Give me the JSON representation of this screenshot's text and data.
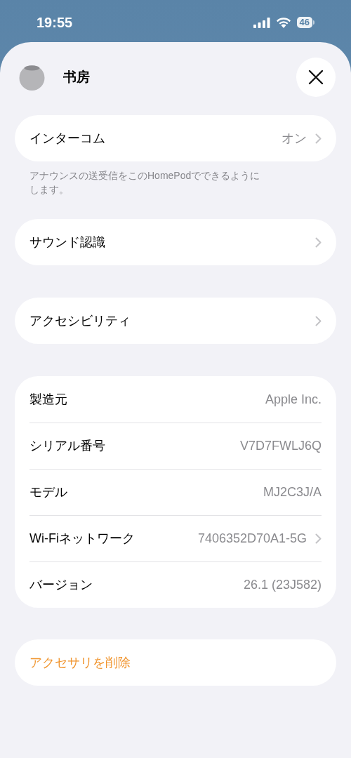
{
  "status_bar": {
    "time": "19:55",
    "battery": "46"
  },
  "header": {
    "title": "书房"
  },
  "groups": [
    {
      "rows": [
        {
          "label": "インターコム",
          "value": "オン",
          "chevron": true
        }
      ],
      "footer": "アナウンスの送受信をこのHomePodでできるようにします。"
    },
    {
      "rows": [
        {
          "label": "サウンド認識",
          "chevron": true
        }
      ]
    },
    {
      "rows": [
        {
          "label": "アクセシビリティ",
          "chevron": true
        }
      ]
    },
    {
      "rows": [
        {
          "label": "製造元",
          "value": "Apple Inc.",
          "chevron": false
        },
        {
          "label": "シリアル番号",
          "value": "V7D7FWLJ6Q",
          "chevron": false
        },
        {
          "label": "モデル",
          "value": "MJ2C3J/A",
          "chevron": false
        },
        {
          "label": "Wi-Fiネットワーク",
          "value": "7406352D70A1-5G",
          "chevron": true
        },
        {
          "label": "バージョン",
          "value": "26.1 (23J582)",
          "chevron": false
        }
      ]
    }
  ],
  "remove_button": {
    "label": "アクセサリを削除"
  }
}
